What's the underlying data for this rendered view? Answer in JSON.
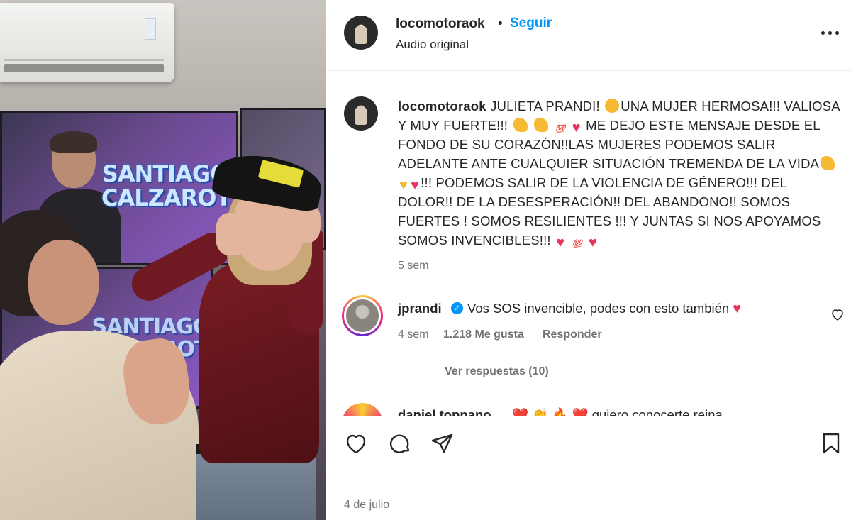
{
  "header": {
    "username": "locomotoraok",
    "separator": "•",
    "follow_label": "Seguir",
    "audio_label": "Audio original"
  },
  "caption": {
    "username": "locomotoraok",
    "text_1": "JULIETA PRANDI!",
    "text_2": "UNA MUJER HERMOSA!!! VALIOSA Y MUY FUERTE!!!",
    "text_3": "ME DEJO ESTE MENSAJE DESDE EL FONDO DE SU CORAZÓN!!LAS MUJERES PODEMOS SALIR ADELANTE ANTE CUALQUIER SITUACIÓN TREMENDA DE LA VIDA",
    "text_4": "!!! PODEMOS SALIR DE LA VIOLENCIA DE GÉNERO!!! DEL DOLOR!! DE LA DESESPERACIÓN!! DEL ABANDONO!! SOMOS FUERTES ! SOMOS RESILIENTES !!! Y JUNTAS SI NOS APOYAMOS SOMOS INVENCIBLES!!!",
    "emoji_100": "💯",
    "time": "5 sem"
  },
  "comment": {
    "username": "jprandi",
    "verified_mark": "✓",
    "text": "Vos SOS invencible, podes con esto también",
    "time": "4 sem",
    "likes": "1.218 Me gusta",
    "reply_label": "Responder",
    "view_replies": "Ver respuestas (10)"
  },
  "comment_2": {
    "username": "daniel.toppano",
    "text": "❤️ 👏 🔥 ❤️ quiero conocerte reina"
  },
  "media": {
    "screen_text": "SANTIAGO CALZAROTTO"
  },
  "footer": {
    "date": "4 de julio"
  },
  "icons": {
    "like": "heart-icon",
    "comment": "comment-icon",
    "share": "share-icon",
    "save": "bookmark-icon",
    "more": "more-options-icon"
  },
  "colors": {
    "link_blue": "#0095f6",
    "heart_red": "#e8345b",
    "secondary_text": "#737373"
  }
}
